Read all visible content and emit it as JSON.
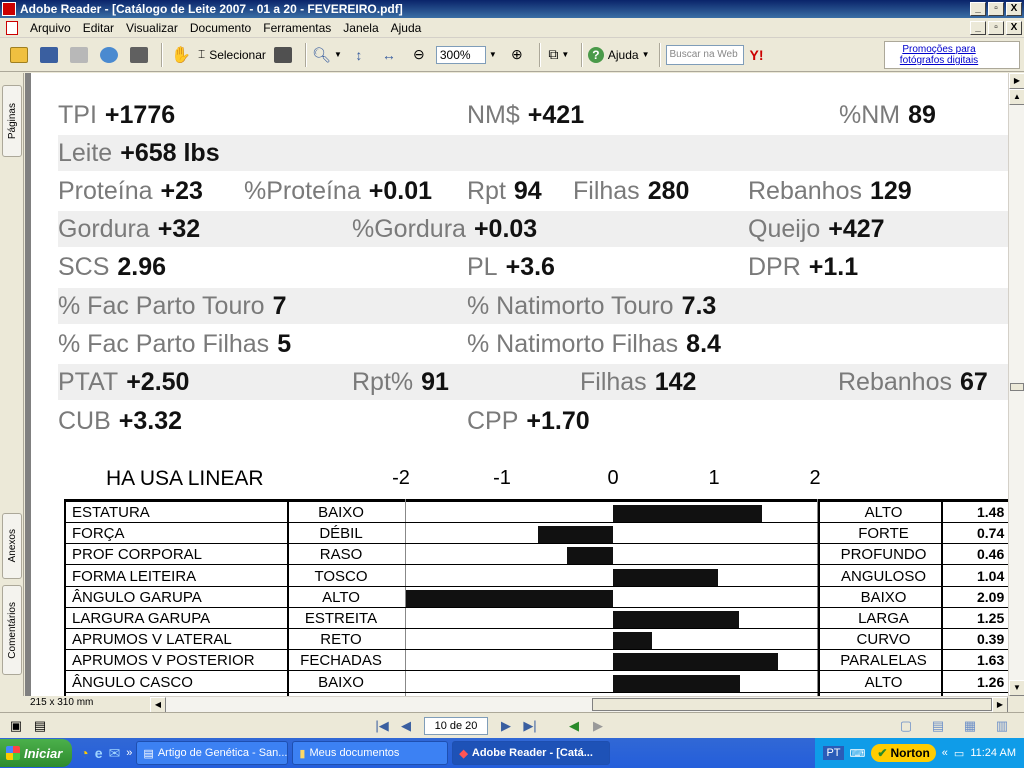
{
  "window": {
    "title": "Adobe Reader - [Catálogo de Leite 2007 - 01 a 20 - FEVEREIRO.pdf]",
    "controls": [
      "_",
      "▫",
      "X"
    ]
  },
  "menu": [
    "Arquivo",
    "Editar",
    "Visualizar",
    "Documento",
    "Ferramentas",
    "Janela",
    "Ajuda"
  ],
  "toolbar": {
    "select_label": "Selecionar",
    "zoom_value": "300%",
    "help_label": "Ajuda",
    "search_placeholder": "Buscar na Web",
    "promo_text": "Promoções para fotógrafos digitais"
  },
  "side_tabs": [
    "Páginas",
    "Anexos",
    "Comentários"
  ],
  "stats": [
    {
      "label": "TPI",
      "value": "+1776"
    },
    {
      "label": "NM$",
      "value": "+421"
    },
    {
      "label": "%NM",
      "value": "89"
    },
    {
      "label": "Leite",
      "value": "+658 lbs"
    },
    {
      "label": "Proteína",
      "value": "+23"
    },
    {
      "label": "%Proteína",
      "value": "+0.01"
    },
    {
      "label": "Rpt",
      "value": "94"
    },
    {
      "label": "Filhas",
      "value": "280"
    },
    {
      "label": "Rebanhos",
      "value": "129"
    },
    {
      "label": "Gordura",
      "value": "+32"
    },
    {
      "label": "%Gordura",
      "value": "+0.03"
    },
    {
      "label": "Queijo",
      "value": "+427"
    },
    {
      "label": "SCS",
      "value": "2.96"
    },
    {
      "label": "PL",
      "value": "+3.6"
    },
    {
      "label": "DPR",
      "value": "+1.1"
    },
    {
      "label": "% Fac Parto Touro",
      "value": "7"
    },
    {
      "label": "% Natimorto Touro",
      "value": "7.3"
    },
    {
      "label": "% Fac Parto Filhas",
      "value": "5"
    },
    {
      "label": "% Natimorto Filhas",
      "value": "8.4"
    },
    {
      "label": "PTAT",
      "value": "+2.50"
    },
    {
      "label": "Rpt%",
      "value": "91"
    },
    {
      "label": "Filhas",
      "value": "142"
    },
    {
      "label": "Rebanhos",
      "value": "67"
    },
    {
      "label": "CUB",
      "value": "+3.32"
    },
    {
      "label": "CPP",
      "value": "+1.70"
    }
  ],
  "linear": {
    "title": "HA USA LINEAR",
    "axis_ticks": [
      "-2",
      "-1",
      "0",
      "1",
      "2"
    ],
    "rows": [
      {
        "trait": "ESTATURA",
        "low": "BAIXO",
        "high": "ALTO",
        "value": 1.48,
        "label": "1.48"
      },
      {
        "trait": "FORÇA",
        "low": "DÉBIL",
        "high": "FORTE",
        "value": 0.74,
        "label": "0.74"
      },
      {
        "trait": "PROF CORPORAL",
        "low": "RASO",
        "high": "PROFUNDO",
        "value": 0.46,
        "label": "0.46"
      },
      {
        "trait": "FORMA LEITEIRA",
        "low": "TOSCO",
        "high": "ANGULOSO",
        "value": 1.04,
        "label": "1.04"
      },
      {
        "trait": "ÂNGULO GARUPA",
        "low": "ALTO",
        "high": "BAIXO",
        "value": 2.09,
        "label": "2.09"
      },
      {
        "trait": "LARGURA GARUPA",
        "low": "ESTREITA",
        "high": "LARGA",
        "value": 1.25,
        "label": "1.25"
      },
      {
        "trait": "APRUMOS V LATERAL",
        "low": "RETO",
        "high": "CURVO",
        "value": 0.39,
        "label": "0.39"
      },
      {
        "trait": "APRUMOS V POSTERIOR",
        "low": "FECHADAS",
        "high": "PARALELAS",
        "value": 1.63,
        "label": "1.63"
      },
      {
        "trait": "ÂNGULO CASCO",
        "low": "BAIXO",
        "high": "ALTO",
        "value": 1.26,
        "label": "1.26"
      }
    ]
  },
  "status": {
    "page_size": "215 x 310 mm",
    "page_indicator": "10 de 20"
  },
  "taskbar": {
    "start": "Iniciar",
    "tasks": [
      "Artigo de Genética - San...",
      "Meus documentos",
      "Adobe Reader - [Catá..."
    ],
    "lang": "PT",
    "norton": "Norton",
    "clock": "11:24 AM"
  }
}
